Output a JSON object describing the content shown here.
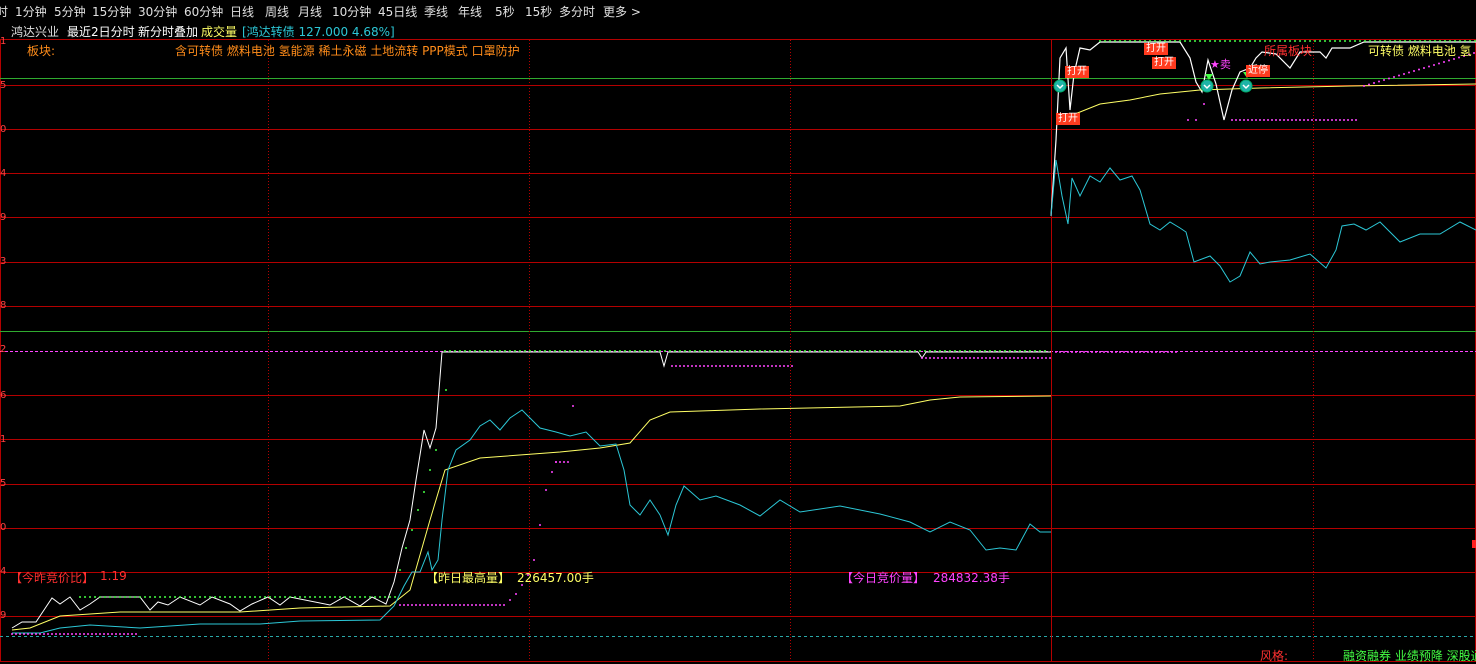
{
  "toolbar": {
    "items": [
      "1分钟",
      "5分钟",
      "15分钟",
      "30分钟",
      "60分钟",
      "日线",
      "周线",
      "月线",
      "10分钟",
      "45日线",
      "季线",
      "年线",
      "5秒",
      "15秒",
      "多分时",
      "更多 >"
    ],
    "edge_char": "时"
  },
  "info": {
    "stock_name": "鸿达兴业",
    "mode": "最近2日分时",
    "overlay": "新分时叠加",
    "volume_label": "成交量",
    "bond_label": "[鸿达转债 127.000 4.68%]"
  },
  "board": {
    "label": "板块:",
    "tags": "含可转债 燃料电池 氢能源 稀土永磁 土地流转 PPP模式 口罩防护",
    "right_tags": "可转债 燃料电池 氢"
  },
  "y_tick_labels": [
    "1",
    "5",
    "0",
    "4",
    "9",
    "3",
    "8",
    "2",
    "6",
    "1",
    "5",
    "0",
    "4",
    "9"
  ],
  "annotations": {
    "auction_ratio_label": "【今昨竞价比】",
    "auction_ratio_value": "1.19",
    "yday_max_label": "【昨日最高量】",
    "yday_max_value": "226457.00手",
    "today_auction_label": "【今日竞价量】",
    "today_auction_value": "284832.38手"
  },
  "signals": {
    "open1": "打开",
    "open2": "打开",
    "open3": "打开",
    "open4": "打开",
    "sell": "★卖",
    "near": "近停",
    "belong": "所属板块"
  },
  "footer": {
    "style_label": "风格:",
    "style_tags": "融资融券 业绩预降 深股通"
  },
  "colors": {
    "price": "#ffffff",
    "avg": "#ffff66",
    "cyan": "#2cc7d6",
    "grid": "#b40000",
    "magenta": "#ff44ff",
    "green": "#44ff44"
  }
}
